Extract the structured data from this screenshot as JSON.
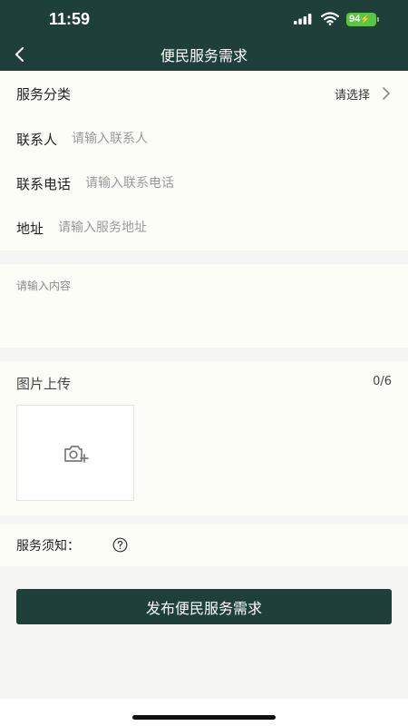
{
  "status_bar": {
    "time": "11:59",
    "battery": "94",
    "signal_icon": "cellular-signal-icon",
    "wifi_icon": "wifi-icon"
  },
  "nav": {
    "title": "便民服务需求",
    "back_icon": "chevron-left-icon"
  },
  "form": {
    "category": {
      "label": "服务分类",
      "value": "请选择"
    },
    "contact": {
      "label": "联系人",
      "placeholder": "请输入联系人",
      "value": ""
    },
    "phone": {
      "label": "联系电话",
      "placeholder": "请输入联系电话",
      "value": ""
    },
    "address": {
      "label": "地址",
      "placeholder": "请输入服务地址",
      "value": ""
    },
    "content": {
      "placeholder": "请输入内容",
      "value": ""
    }
  },
  "upload": {
    "title": "图片上传",
    "count": "0/6",
    "icon": "camera-plus-icon"
  },
  "notice": {
    "label": "服务须知：",
    "icon": "question-circle-icon"
  },
  "submit_label": "发布便民服务需求",
  "colors": {
    "primary": "#1f3f3b",
    "card_bg": "#fdfdf8",
    "page_bg": "#f5f5f3",
    "battery": "#5ac444"
  }
}
